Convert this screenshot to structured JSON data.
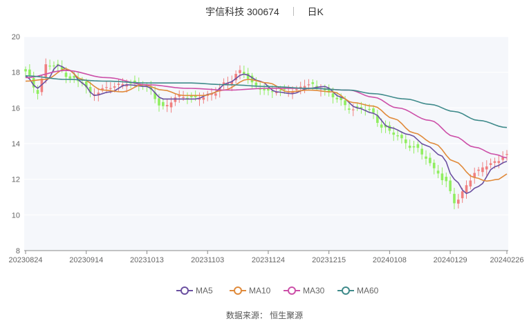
{
  "header": {
    "stock": "宇信科技 300674",
    "period": "日K"
  },
  "source": "数据来源： 恒生聚源",
  "chart_data": {
    "type": "candlestick",
    "y_ticks": [
      "8",
      "10",
      "12",
      "14",
      "16",
      "18",
      "20"
    ],
    "ylim": [
      8,
      20
    ],
    "x_ticks": [
      "20230824",
      "20230914",
      "20231013",
      "20231103",
      "20231124",
      "20231215",
      "20240108",
      "20240129",
      "20240226"
    ],
    "n_days": 120,
    "tick_index": [
      0,
      15,
      30,
      45,
      60,
      75,
      90,
      105,
      119
    ],
    "grid": "horizontal",
    "legend_position": "bottom-center",
    "colors": {
      "up": "#f08080",
      "down": "#90ee60",
      "plot_bg": "#f5f7fb"
    },
    "candle_anchors": [
      [
        0,
        18.0
      ],
      [
        3,
        16.9
      ],
      [
        5,
        18.4
      ],
      [
        8,
        18.3
      ],
      [
        11,
        17.7
      ],
      [
        14,
        17.4
      ],
      [
        16,
        16.8
      ],
      [
        20,
        17.1
      ],
      [
        25,
        17.4
      ],
      [
        30,
        17.2
      ],
      [
        34,
        16.0
      ],
      [
        38,
        16.7
      ],
      [
        42,
        16.5
      ],
      [
        46,
        16.8
      ],
      [
        50,
        17.4
      ],
      [
        53,
        18.1
      ],
      [
        57,
        17.2
      ],
      [
        61,
        16.9
      ],
      [
        66,
        17.0
      ],
      [
        70,
        17.3
      ],
      [
        73,
        17.1
      ],
      [
        77,
        16.5
      ],
      [
        80,
        16.0
      ],
      [
        85,
        15.9
      ],
      [
        88,
        15.0
      ],
      [
        91,
        14.5
      ],
      [
        96,
        13.8
      ],
      [
        99,
        13.2
      ],
      [
        101,
        12.6
      ],
      [
        104,
        11.8
      ],
      [
        106,
        10.7
      ],
      [
        107,
        10.9
      ],
      [
        109,
        11.7
      ],
      [
        111,
        12.3
      ],
      [
        114,
        12.8
      ],
      [
        116,
        13.0
      ],
      [
        119,
        13.3
      ]
    ],
    "series": [
      {
        "name": "MA5",
        "color": "#6a4fa0",
        "anchors": [
          [
            0,
            17.8
          ],
          [
            3,
            17.1
          ],
          [
            5,
            17.5
          ],
          [
            8,
            18.4
          ],
          [
            11,
            18.1
          ],
          [
            14,
            17.4
          ],
          [
            17,
            16.7
          ],
          [
            21,
            16.9
          ],
          [
            25,
            17.3
          ],
          [
            30,
            17.2
          ],
          [
            34,
            16.5
          ],
          [
            38,
            16.5
          ],
          [
            42,
            16.5
          ],
          [
            46,
            16.8
          ],
          [
            50,
            17.4
          ],
          [
            54,
            17.9
          ],
          [
            58,
            17.5
          ],
          [
            62,
            16.9
          ],
          [
            66,
            16.8
          ],
          [
            70,
            17.1
          ],
          [
            74,
            17.2
          ],
          [
            78,
            16.6
          ],
          [
            82,
            16.0
          ],
          [
            86,
            15.7
          ],
          [
            90,
            14.9
          ],
          [
            95,
            14.5
          ],
          [
            99,
            13.9
          ],
          [
            103,
            13.3
          ],
          [
            106,
            12.0
          ],
          [
            109,
            11.2
          ],
          [
            112,
            11.6
          ],
          [
            116,
            12.7
          ],
          [
            119,
            13.0
          ]
        ]
      },
      {
        "name": "MA10",
        "color": "#e08a3a",
        "anchors": [
          [
            0,
            17.5
          ],
          [
            5,
            17.6
          ],
          [
            10,
            18.2
          ],
          [
            14,
            17.6
          ],
          [
            19,
            17.0
          ],
          [
            24,
            16.9
          ],
          [
            29,
            17.3
          ],
          [
            34,
            17.0
          ],
          [
            39,
            16.7
          ],
          [
            44,
            16.7
          ],
          [
            49,
            17.0
          ],
          [
            55,
            17.6
          ],
          [
            60,
            17.4
          ],
          [
            65,
            16.9
          ],
          [
            70,
            17.0
          ],
          [
            76,
            16.9
          ],
          [
            81,
            16.3
          ],
          [
            86,
            16.1
          ],
          [
            91,
            15.4
          ],
          [
            96,
            14.6
          ],
          [
            101,
            14.0
          ],
          [
            106,
            13.0
          ],
          [
            111,
            12.1
          ],
          [
            114,
            11.9
          ],
          [
            117,
            12.0
          ],
          [
            119,
            12.3
          ]
        ]
      },
      {
        "name": "MA30",
        "color": "#cc4fa8",
        "anchors": [
          [
            0,
            17.7
          ],
          [
            10,
            18.1
          ],
          [
            20,
            17.7
          ],
          [
            30,
            17.3
          ],
          [
            40,
            17.1
          ],
          [
            50,
            17.0
          ],
          [
            60,
            17.1
          ],
          [
            70,
            17.1
          ],
          [
            80,
            17.0
          ],
          [
            86,
            16.6
          ],
          [
            92,
            16.0
          ],
          [
            100,
            15.3
          ],
          [
            106,
            14.4
          ],
          [
            111,
            13.8
          ],
          [
            116,
            13.4
          ],
          [
            119,
            13.2
          ]
        ]
      },
      {
        "name": "MA60",
        "color": "#3e8a8a",
        "anchors": [
          [
            0,
            17.8
          ],
          [
            10,
            17.6
          ],
          [
            20,
            17.5
          ],
          [
            30,
            17.4
          ],
          [
            40,
            17.4
          ],
          [
            50,
            17.3
          ],
          [
            60,
            17.2
          ],
          [
            70,
            17.1
          ],
          [
            80,
            17.0
          ],
          [
            86,
            16.8
          ],
          [
            94,
            16.5
          ],
          [
            100,
            16.2
          ],
          [
            106,
            15.8
          ],
          [
            112,
            15.3
          ],
          [
            119,
            14.9
          ]
        ]
      }
    ]
  }
}
